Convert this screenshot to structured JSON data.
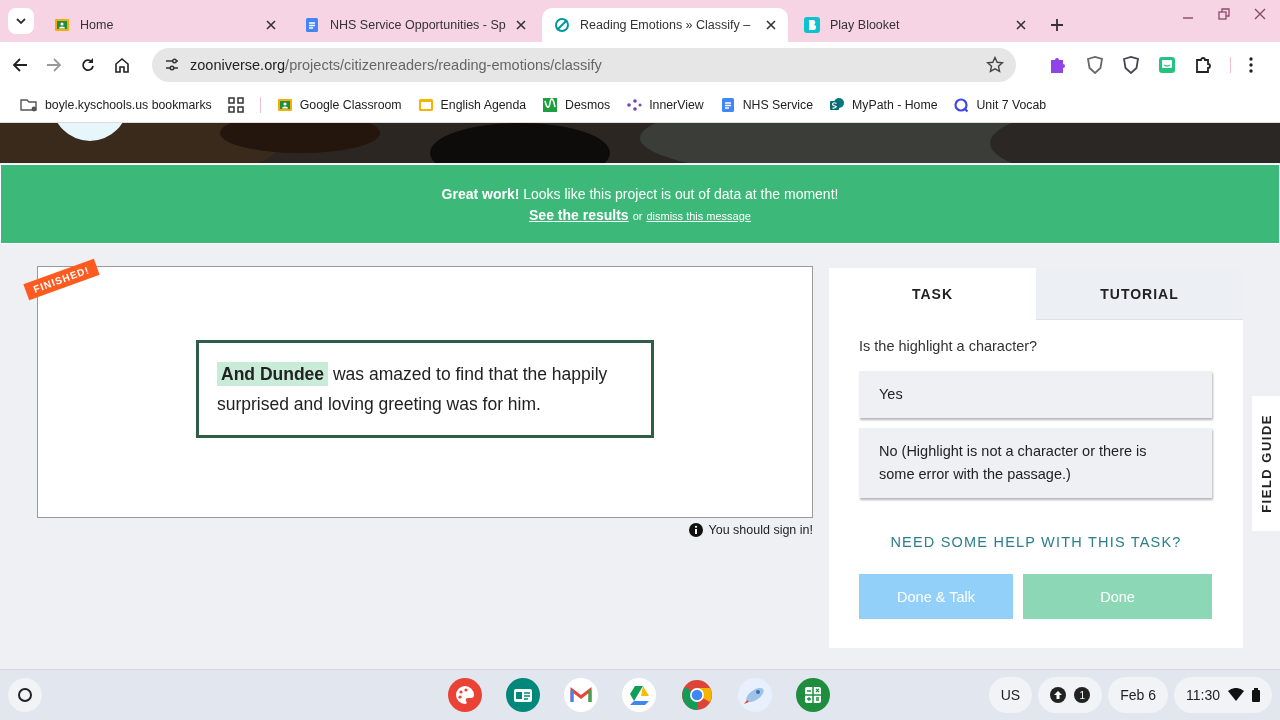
{
  "browser": {
    "tabs": [
      {
        "title": "Home",
        "selected": false
      },
      {
        "title": "NHS Service Opportunities - Sp",
        "selected": false
      },
      {
        "title": "Reading Emotions » Classify –",
        "selected": true
      },
      {
        "title": "Play Blooket",
        "selected": false
      }
    ],
    "address": {
      "domain": "zooniverse.org",
      "path": "/projects/citizenreaders/reading-emotions/classify"
    },
    "bookmarks": [
      {
        "kind": "folder",
        "label": "boyle.kyschools.us bookmarks"
      },
      {
        "kind": "apps"
      },
      {
        "kind": "link",
        "label": "Google Classroom"
      },
      {
        "kind": "link",
        "label": "English Agenda"
      },
      {
        "kind": "link",
        "label": "Desmos"
      },
      {
        "kind": "link",
        "label": "InnerView"
      },
      {
        "kind": "link",
        "label": "NHS Service"
      },
      {
        "kind": "link",
        "label": "MyPath - Home"
      },
      {
        "kind": "link",
        "label": "Unit 7 Vocab"
      }
    ]
  },
  "banner": {
    "lead": "Great work!",
    "message": "Looks like this project is out of data at the moment!",
    "results_link": "See the results",
    "or": "or",
    "dismiss_link": "dismiss this message"
  },
  "subject": {
    "badge": "FINISHED!",
    "highlight": "And Dundee",
    "text": "was amazed to find that the happily surprised and loving greeting was for him.",
    "sign_in_note": "You should sign in!"
  },
  "task_panel": {
    "tabs": [
      {
        "label": "TASK",
        "selected": true
      },
      {
        "label": "TUTORIAL",
        "selected": false
      }
    ],
    "question": "Is the highlight a character?",
    "answers": [
      {
        "label": "Yes",
        "selected": false
      },
      {
        "label": "No (Highlight is not a character or there is some error with the passage.)",
        "selected": false
      }
    ],
    "help_link": "NEED SOME HELP WITH THIS TASK?",
    "buttons": [
      {
        "label": "Done & Talk",
        "kind": "talk",
        "disabled": true
      },
      {
        "label": "Done",
        "kind": "done",
        "disabled": true
      }
    ]
  },
  "field_guide": {
    "label": "FIELD GUIDE"
  },
  "shelf": {
    "ime": "US",
    "notifications": "1",
    "date": "Feb 6",
    "time": "11:30"
  }
}
